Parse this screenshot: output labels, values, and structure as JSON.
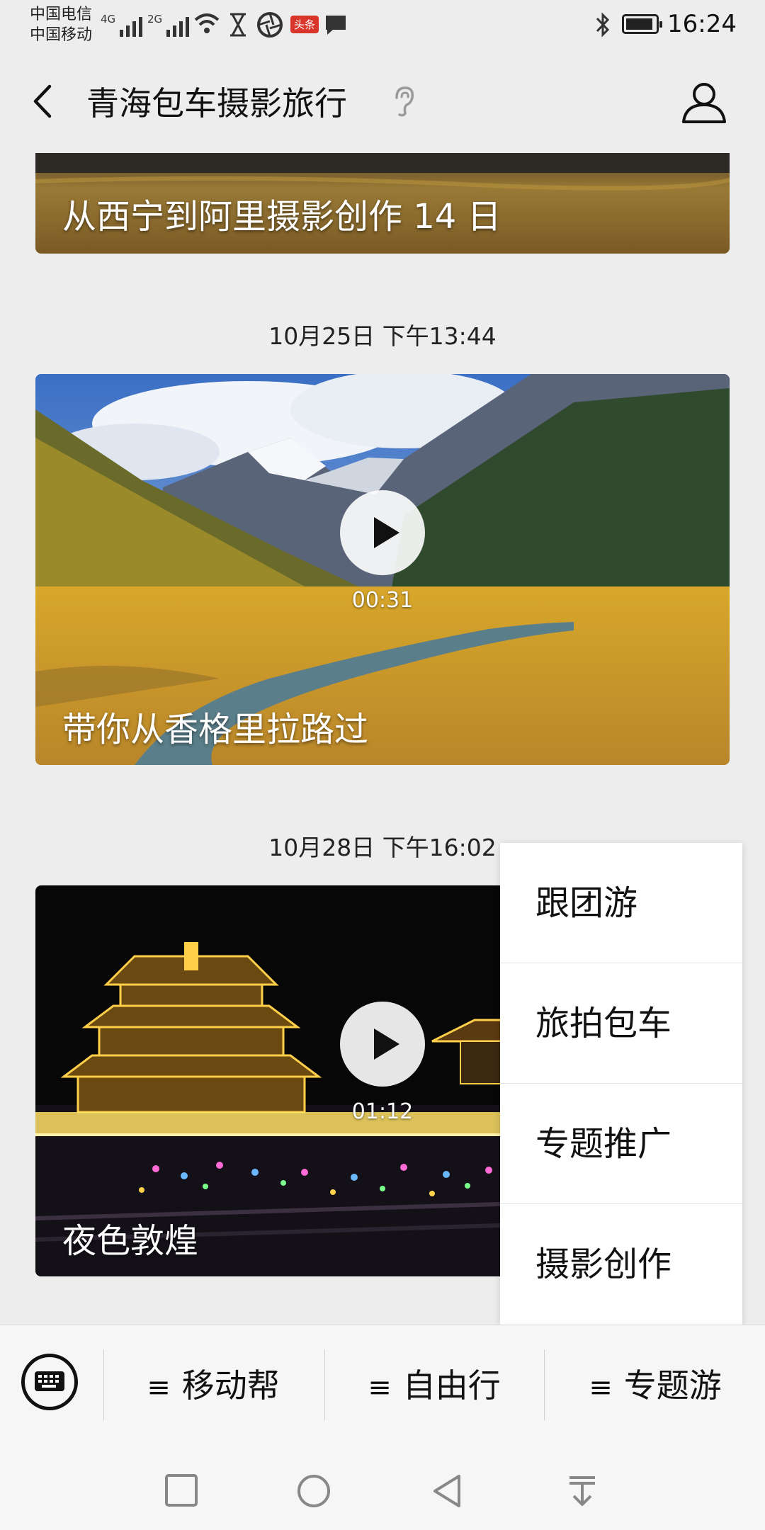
{
  "status": {
    "carrier1": "中国电信",
    "carrier2": "中国移动",
    "gen1": "4G",
    "gen2": "2G",
    "news_badge": "头条",
    "time": "16:24"
  },
  "header": {
    "title": "青海包车摄影旅行"
  },
  "posts": [
    {
      "caption": "从西宁到阿里摄影创作 14 日"
    },
    {
      "date": "10月25日 下午13:44",
      "caption": "带你从香格里拉路过",
      "duration": "00:31"
    },
    {
      "date": "10月28日 下午16:02",
      "caption": "夜色敦煌",
      "duration": "01:12"
    }
  ],
  "popup": {
    "items": [
      "跟团游",
      "旅拍包车",
      "专题推广",
      "摄影创作"
    ]
  },
  "menu": {
    "items": [
      "移动帮",
      "自由行",
      "专题游"
    ]
  },
  "colors": {
    "background": "#ededed",
    "menu_bar": "#f6f6f6",
    "badge": "#d9352b"
  }
}
